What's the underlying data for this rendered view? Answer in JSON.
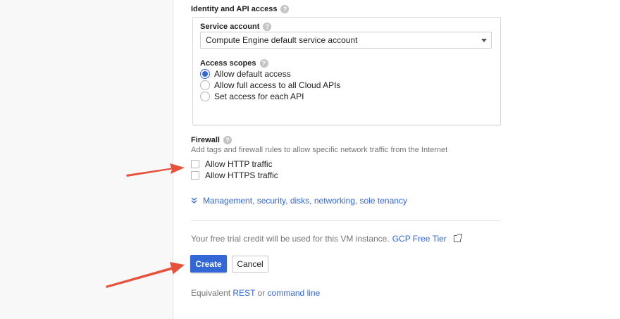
{
  "identity": {
    "title": "Identity and API access",
    "help_glyph": "?",
    "service_account": {
      "label": "Service account",
      "value": "Compute Engine default service account"
    },
    "access_scopes": {
      "label": "Access scopes",
      "options": [
        {
          "label": "Allow default access",
          "checked": true
        },
        {
          "label": "Allow full access to all Cloud APIs",
          "checked": false
        },
        {
          "label": "Set access for each API",
          "checked": false
        }
      ]
    }
  },
  "firewall": {
    "title": "Firewall",
    "description": "Add tags and firewall rules to allow specific network traffic from the Internet",
    "options": [
      {
        "label": "Allow HTTP traffic",
        "checked": false
      },
      {
        "label": "Allow HTTPS traffic",
        "checked": false
      }
    ]
  },
  "management_link": "Management, security, disks, networking, sole tenancy",
  "trial": {
    "text": "Your free trial credit will be used for this VM instance.",
    "link": "GCP Free Tier"
  },
  "buttons": {
    "create": "Create",
    "cancel": "Cancel"
  },
  "equivalent": {
    "prefix": "Equivalent",
    "rest": "REST",
    "or": "or",
    "command_line": "command line"
  },
  "colors": {
    "accent": "#3367d6",
    "annotation_arrow": "#e8513a"
  },
  "icons": {
    "help": "help-icon",
    "dropdown": "caret-down-icon",
    "expand": "chevron-double-down-icon",
    "external": "external-link-icon"
  }
}
